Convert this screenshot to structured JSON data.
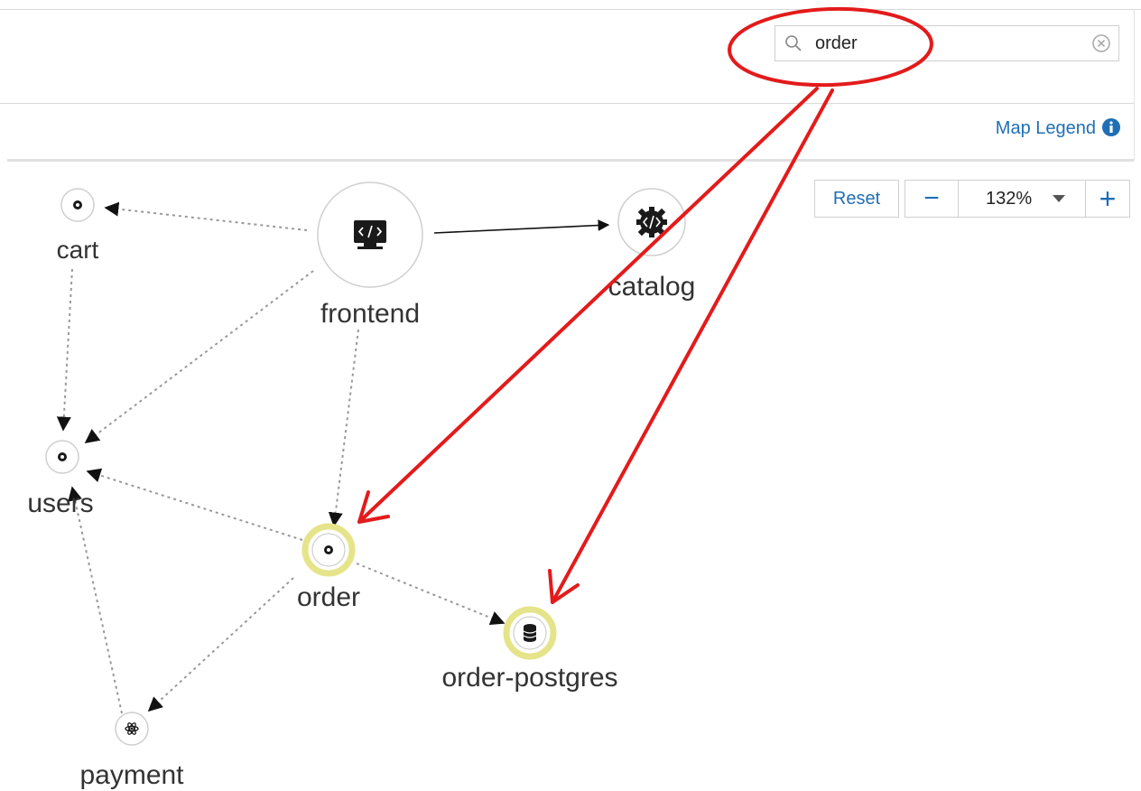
{
  "search": {
    "value": "order"
  },
  "legend": {
    "label": "Map Legend"
  },
  "zoom": {
    "reset_label": "Reset",
    "minus_label": "−",
    "level": "132%",
    "plus_label": "+"
  },
  "nodes": {
    "frontend": "frontend",
    "catalog": "catalog",
    "cart": "cart",
    "users": "users",
    "order": "order",
    "order_postgres": "order-postgres",
    "payment": "payment"
  },
  "colors": {
    "link": "#1f6fb5",
    "highlight": "#e6e48a",
    "annotation": "#e31b1b",
    "edge": "#999999"
  }
}
